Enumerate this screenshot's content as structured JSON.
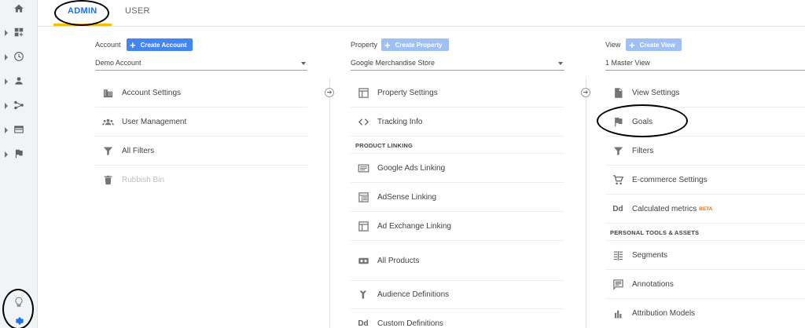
{
  "tabs": {
    "admin": "ADMIN",
    "user": "USER"
  },
  "account": {
    "label": "Account",
    "create_label": "Create Account",
    "selected": "Demo Account",
    "items": [
      {
        "label": "Account Settings",
        "icon": "building-icon"
      },
      {
        "label": "User Management",
        "icon": "people-icon"
      },
      {
        "label": "All Filters",
        "icon": "filter-icon"
      },
      {
        "label": "Rubbish Bin",
        "icon": "trash-icon"
      }
    ]
  },
  "property": {
    "label": "Property",
    "create_label": "Create Property",
    "selected": "Google Merchandise Store",
    "items": [
      {
        "label": "Property Settings",
        "icon": "window-icon"
      },
      {
        "label": "Tracking Info",
        "icon": "code-icon"
      }
    ],
    "linking_header": "PRODUCT LINKING",
    "linking_items": [
      {
        "label": "Google Ads Linking",
        "icon": "ads-icon"
      },
      {
        "label": "AdSense Linking",
        "icon": "adsense-icon"
      },
      {
        "label": "Ad Exchange Linking",
        "icon": "window-icon"
      },
      {
        "label": "All Products",
        "icon": "link-icon"
      }
    ],
    "more_items": [
      {
        "label": "Audience Definitions",
        "icon": "fork-icon"
      },
      {
        "label": "Custom Definitions",
        "icon": "dd-icon"
      }
    ]
  },
  "view": {
    "label": "View",
    "create_label": "Create View",
    "selected": "1 Master View",
    "items": [
      {
        "label": "View Settings",
        "icon": "document-icon"
      },
      {
        "label": "Goals",
        "icon": "flag-icon"
      },
      {
        "label": "Filters",
        "icon": "filter-icon"
      },
      {
        "label": "E-commerce Settings",
        "icon": "cart-icon"
      },
      {
        "label": "Calculated metrics",
        "icon": "dd-icon",
        "badge": "BETA"
      }
    ],
    "tools_header": "PERSONAL TOOLS & ASSETS",
    "tools_items": [
      {
        "label": "Segments",
        "icon": "segments-icon"
      },
      {
        "label": "Annotations",
        "icon": "comment-icon"
      },
      {
        "label": "Attribution Models",
        "icon": "bars-icon"
      }
    ]
  },
  "colors": {
    "accent": "#1a73e8",
    "button": "#4285f4",
    "button_disabled": "#9fc0f5",
    "tab_underline": "#fbbc04",
    "beta": "#e8710a"
  }
}
